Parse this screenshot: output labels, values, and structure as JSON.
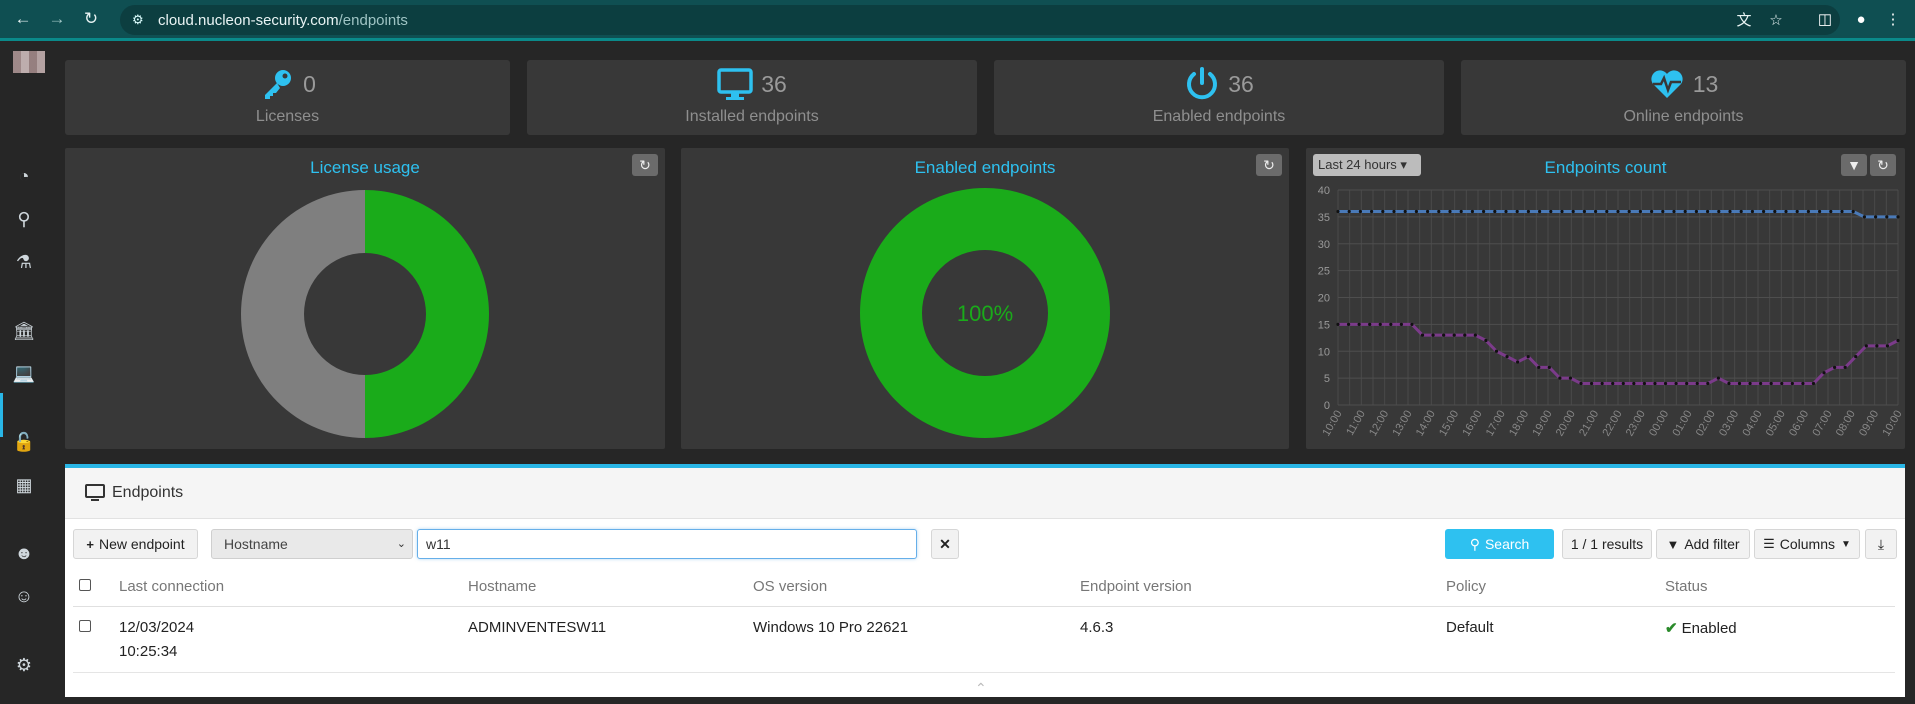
{
  "browser": {
    "url_host": "cloud.nucleon-security.com",
    "url_path": "/endpoints"
  },
  "stats": [
    {
      "label": "Licenses",
      "value": "0",
      "icon": "key-icon"
    },
    {
      "label": "Installed endpoints",
      "value": "36",
      "icon": "monitor-icon"
    },
    {
      "label": "Enabled endpoints",
      "value": "36",
      "icon": "power-icon"
    },
    {
      "label": "Online endpoints",
      "value": "13",
      "icon": "heartbeat-icon"
    }
  ],
  "panels": {
    "license_usage": {
      "title": "License usage"
    },
    "enabled_endpoints": {
      "title": "Enabled endpoints",
      "center_label": "100%"
    },
    "endpoints_count": {
      "title": "Endpoints count",
      "range": "Last 24 hours"
    }
  },
  "colors": {
    "accent": "#2ec1f0",
    "green": "#1aab1a",
    "gray": "#7f7f7f",
    "series_total": "#4a7ab8",
    "series_online": "#7b3b8a"
  },
  "chart_data": [
    {
      "type": "pie",
      "title": "License usage",
      "values": [
        50,
        50
      ],
      "colors": [
        "#1aab1a",
        "#7f7f7f"
      ]
    },
    {
      "type": "pie",
      "title": "Enabled endpoints",
      "values": [
        100
      ],
      "colors": [
        "#1aab1a"
      ],
      "annotation": "100%"
    },
    {
      "type": "line",
      "title": "Endpoints count",
      "ylim": [
        0,
        40
      ],
      "yticks": [
        0,
        5,
        10,
        15,
        20,
        25,
        30,
        35,
        40
      ],
      "xticks": [
        "10:00",
        "11:00",
        "12:00",
        "13:00",
        "14:00",
        "15:00",
        "16:00",
        "17:00",
        "18:00",
        "19:00",
        "20:00",
        "21:00",
        "22:00",
        "23:00",
        "00:00",
        "01:00",
        "02:00",
        "03:00",
        "04:00",
        "05:00",
        "06:00",
        "07:00",
        "08:00",
        "09:00",
        "10:00"
      ],
      "grid": true,
      "series": [
        {
          "values": [
            36,
            36,
            36,
            36,
            36,
            36,
            36,
            36,
            36,
            36,
            36,
            36,
            36,
            36,
            36,
            36,
            36,
            36,
            36,
            36,
            36,
            36,
            36,
            36,
            36,
            36,
            36,
            36,
            36,
            36,
            36,
            36,
            36,
            36,
            36,
            36,
            36,
            36,
            36,
            36,
            36,
            36,
            36,
            36,
            36,
            36,
            36,
            35,
            35,
            35,
            35
          ],
          "color": "#4a7ab8"
        },
        {
          "values": [
            15,
            15,
            15,
            15,
            15,
            15,
            15,
            15,
            13,
            13,
            13,
            13,
            13,
            13,
            12,
            10,
            9,
            8,
            9,
            7,
            7,
            5,
            5,
            4,
            4,
            4,
            4,
            4,
            4,
            4,
            4,
            4,
            4,
            4,
            4,
            4,
            5,
            4,
            4,
            4,
            4,
            4,
            4,
            4,
            4,
            4,
            6,
            7,
            7,
            9,
            11,
            11,
            11,
            12
          ],
          "color": "#7b3b8a"
        }
      ]
    }
  ],
  "endpoints": {
    "title": "Endpoints",
    "new_endpoint": "New endpoint",
    "filter_field": "Hostname",
    "search_value": "w11",
    "search_label": "Search",
    "results": "1 / 1 results",
    "add_filter": "Add filter",
    "columns": "Columns",
    "headers": [
      "Last connection",
      "Hostname",
      "OS version",
      "Endpoint version",
      "Policy",
      "Status"
    ],
    "rows": [
      {
        "date": "12/03/2024",
        "time": "10:25:34",
        "hostname": "ADMINVENTESW11",
        "os": "Windows 10 Pro 22621",
        "version": "4.6.3",
        "policy": "Default",
        "status": "Enabled"
      }
    ]
  }
}
